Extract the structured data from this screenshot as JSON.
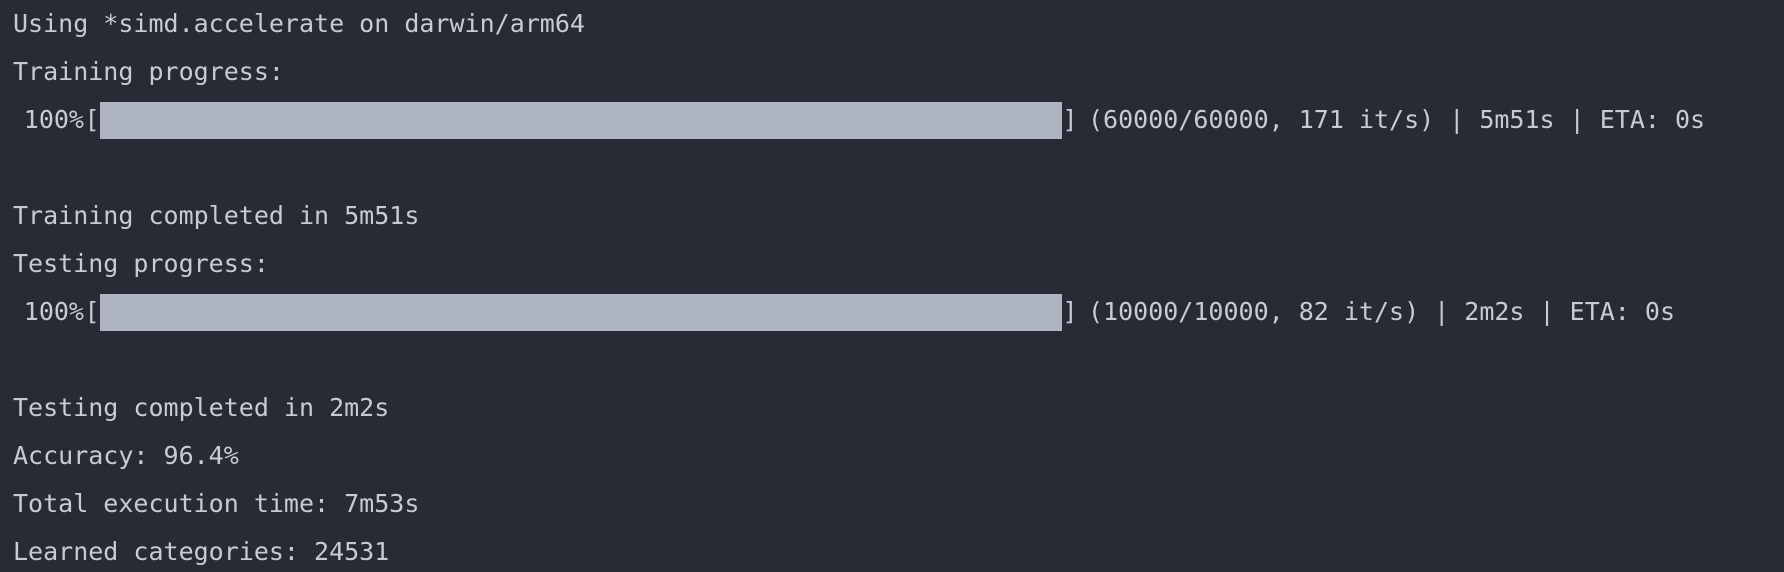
{
  "terminal": {
    "lines": {
      "env": "Using *simd.accelerate on darwin/arm64",
      "training_header": "Training progress:",
      "training_completed": "Training completed in 5m51s",
      "testing_header": "Testing progress:",
      "testing_completed": "Testing completed in 2m2s",
      "accuracy": "Accuracy: 96.4%",
      "total_time": "Total execution time: 7m53s",
      "learned": "Learned categories: 24531"
    },
    "training_bar": {
      "percent_label": "100%",
      "open": "[",
      "close": "]",
      "fraction": 1.0,
      "stats": "(60000/60000, 171 it/s) | 5m51s | ETA: 0s"
    },
    "testing_bar": {
      "percent_label": "100%",
      "open": "[",
      "close": "]",
      "fraction": 1.0,
      "stats": "(10000/10000, 82 it/s) | 2m2s | ETA: 0s"
    },
    "colors": {
      "background": "#282b35",
      "text": "#c8cbd3",
      "bar_fill": "#aeb4c0"
    }
  }
}
